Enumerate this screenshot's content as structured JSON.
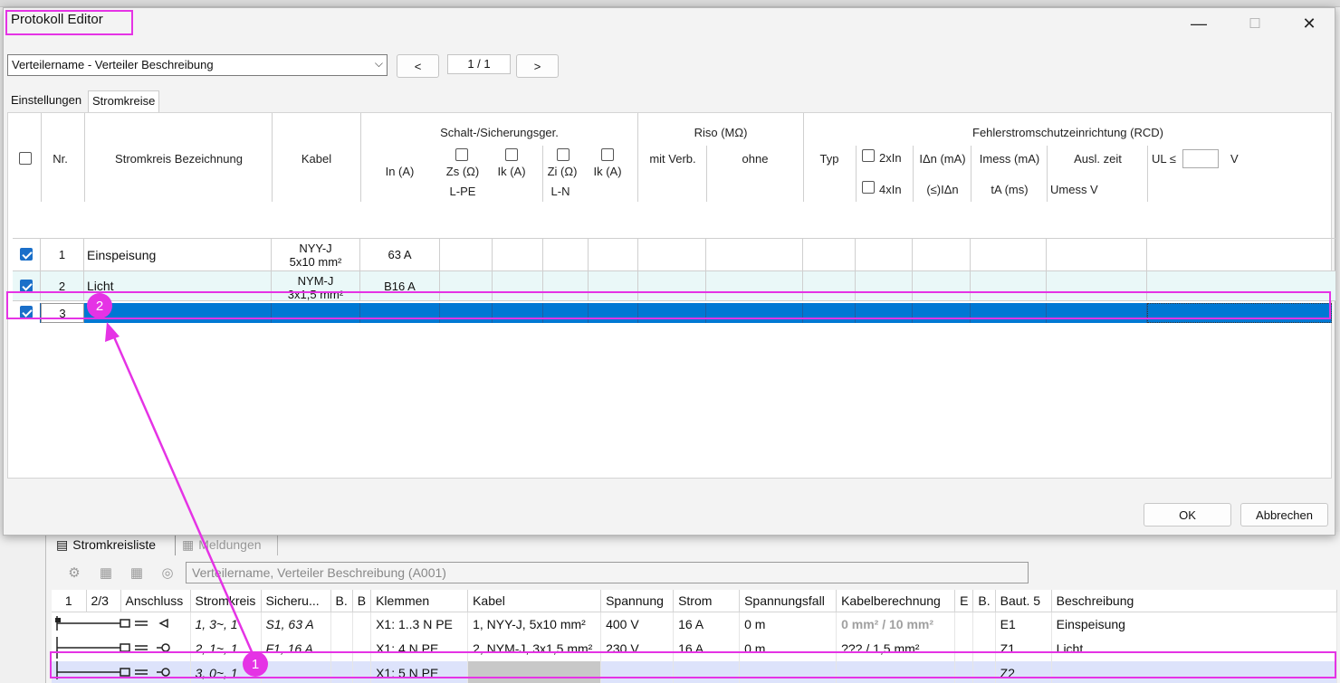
{
  "dialog": {
    "title": "Protokoll Editor",
    "controls": {
      "minimize": "—",
      "maximize": "☐",
      "close": "✕"
    },
    "distributor_select": "Verteilername - Verteiler Beschreibung",
    "prev_label": "<",
    "next_label": ">",
    "page": "1 / 1",
    "tabs": [
      "Einstellungen",
      "Stromkreise"
    ],
    "headers": {
      "nr": "Nr.",
      "bezeichnung": "Stromkreis Bezeichnung",
      "kabel": "Kabel",
      "group_schalt": "Schalt-/Sicherungsger.",
      "in_a": "In (A)",
      "zs": "Zs (Ω)",
      "ik1": "Ik (A)",
      "zi": "Zi (Ω)",
      "ik2": "Ik (A)",
      "lpe": "L-PE",
      "ln": "L-N",
      "group_riso": "Riso (MΩ)",
      "mit_verb": "mit Verb.",
      "ohne": "ohne",
      "group_rcd": "Fehlerstromschutzeinrichtung (RCD)",
      "typ": "Typ",
      "x2": "2xIn",
      "x4": "4xIn",
      "idn": "IΔn (mA)",
      "le_idn": "(≤)IΔn",
      "imess": "Imess (mA)",
      "ta": "tA (ms)",
      "ausl": "Ausl. zeit",
      "umess": "Umess V",
      "ul": "UL ≤",
      "ul_unit": "V",
      "ul_value": ""
    },
    "rows": [
      {
        "checked": true,
        "nr": "1",
        "bezeichnung": "Einspeisung",
        "kabel_line1": "NYY-J",
        "kabel_line2": "5x10 mm²",
        "in": "63 A"
      },
      {
        "checked": true,
        "nr": "2",
        "bezeichnung": "Licht",
        "kabel_line1": "NYM-J",
        "kabel_line2": "3x1,5 mm²",
        "in": "B16 A"
      },
      {
        "checked": true,
        "nr": "3",
        "bezeichnung": "",
        "kabel_line1": "",
        "kabel_line2": "",
        "in": ""
      }
    ],
    "ok_label": "OK",
    "cancel_label": "Abbrechen"
  },
  "background": {
    "tabs": [
      "Stromkreisliste",
      "Meldungen"
    ],
    "path": "Verteilername, Verteiler Beschreibung (A001)",
    "columns": [
      "1",
      "2/3",
      "Anschluss",
      "Stromkreis",
      "Sicheru...",
      "B.",
      "B",
      "Klemmen",
      "Kabel",
      "Spannung",
      "Strom",
      "Spannungsfall",
      "Kabelberechnung",
      "E",
      "B.",
      "Baut. 5",
      "Beschreibung"
    ],
    "rows": [
      {
        "stromkreis": "1, 3~, 1",
        "sicherung": "S1, 63 A",
        "klemmen": "X1: 1..3 N PE",
        "kabel": "1, NYY-J, 5x10 mm²",
        "spannung": "400 V",
        "strom": "16 A",
        "fall": "0 m",
        "berechnung": "0 mm² / 10 mm²",
        "baut": "E1",
        "beschreibung": "Einspeisung"
      },
      {
        "stromkreis": "2, 1~, 1",
        "sicherung": "F1, 16 A",
        "klemmen": "X1: 4 N PE",
        "kabel": "2, NYM-J, 3x1,5 mm²",
        "spannung": "230 V",
        "strom": "16 A",
        "fall": "0 m",
        "berechnung": "??? / 1,5 mm²",
        "baut": "Z1",
        "beschreibung": "Licht"
      },
      {
        "stromkreis": "3, 0~, 1",
        "sicherung": "",
        "klemmen": "X1: 5 N PE",
        "kabel": "",
        "spannung": "",
        "strom": "",
        "fall": "",
        "berechnung": "",
        "baut": "Z2",
        "beschreibung": ""
      }
    ]
  },
  "annotations": {
    "badge1": "1",
    "badge2": "2"
  },
  "colors": {
    "accent": "#0078d4",
    "annotation": "#e533e5",
    "selected_row_bg": "#dde3fb"
  }
}
